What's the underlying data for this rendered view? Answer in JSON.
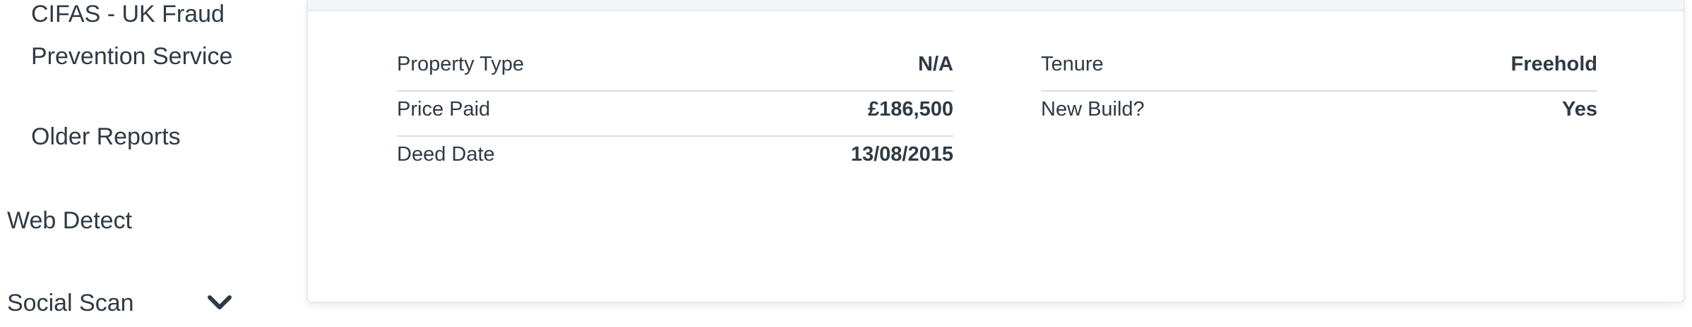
{
  "sidebar": {
    "items": [
      {
        "label_line1": "CIFAS - UK Fraud",
        "label_line2": "Prevention Service"
      },
      {
        "label": "Older Reports"
      },
      {
        "label": "Web Detect"
      },
      {
        "label": "Social Scan",
        "icon": "chevron-down-icon"
      }
    ]
  },
  "property": {
    "left": [
      {
        "label": "Property Type",
        "value": "N/A"
      },
      {
        "label": "Price Paid",
        "value": "£186,500"
      },
      {
        "label": "Deed Date",
        "value": "13/08/2015"
      }
    ],
    "right": [
      {
        "label": "Tenure",
        "value": "Freehold"
      },
      {
        "label": "New Build?",
        "value": "Yes"
      }
    ]
  }
}
